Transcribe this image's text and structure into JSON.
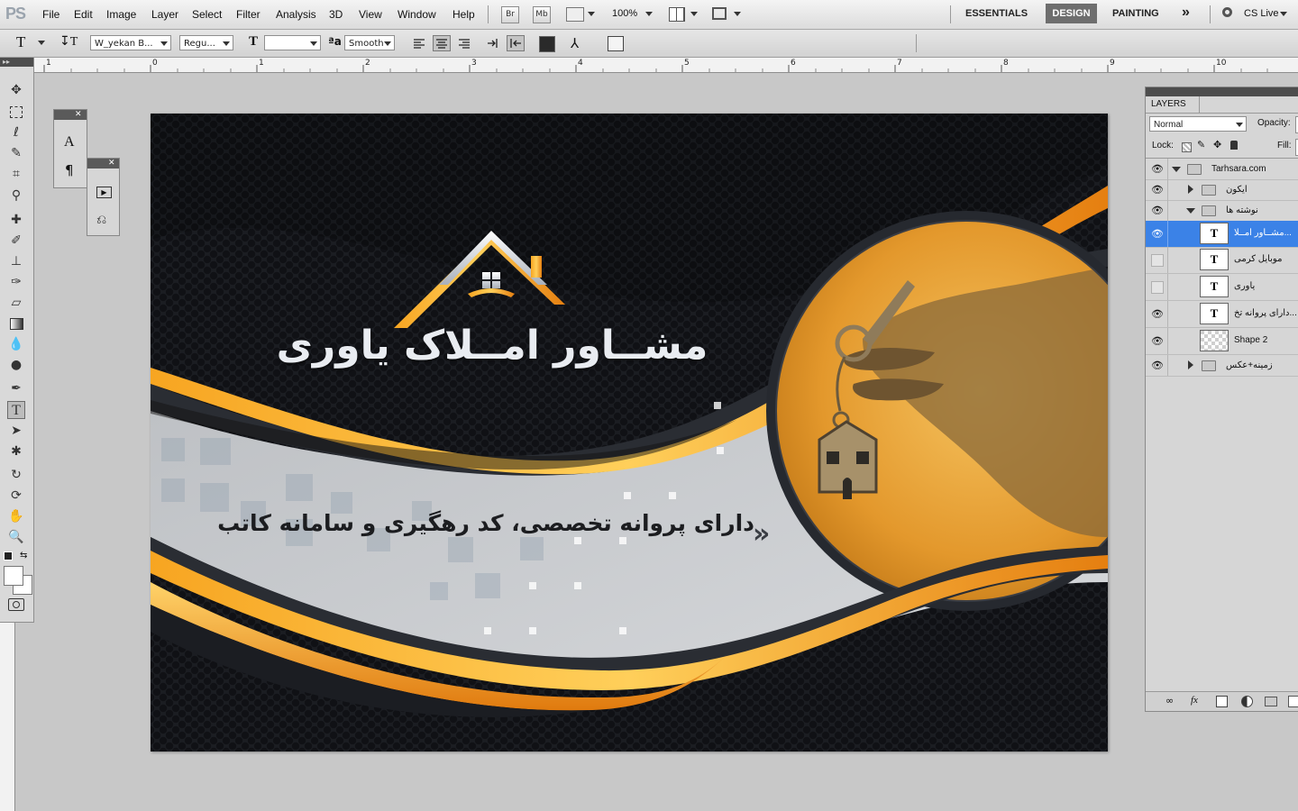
{
  "app": {
    "logo": "PS"
  },
  "menu": [
    "File",
    "Edit",
    "Image",
    "Layer",
    "Select",
    "Filter",
    "Analysis",
    "3D",
    "View",
    "Window",
    "Help"
  ],
  "menubar_buttons": {
    "bridge": "Br",
    "mini_bridge": "Mb",
    "zoom": "100%"
  },
  "workspaces": {
    "essentials": "ESSENTIALS",
    "design": "DESIGN",
    "painting": "PAINTING",
    "more": "»",
    "cs_live": "CS Live"
  },
  "options": {
    "font_family": "W_yekan B...",
    "font_style": "Regu...",
    "font_size": "",
    "aa_label": "a",
    "anti_alias": "Smooth"
  },
  "ruler_numbers": [
    "1",
    "0",
    "1",
    "2",
    "3",
    "4",
    "5",
    "6",
    "7",
    "8",
    "9",
    "10"
  ],
  "card": {
    "company_name": "مشــاور امــلاک یاوری",
    "tagline": "دارای پروانه تخصصی، کد رهگیری و سامانه کاتب",
    "chevrons": "»"
  },
  "layers_panel": {
    "tab": "LAYERS",
    "blend_mode": "Normal",
    "opacity_label": "Opacity:",
    "lock_label": "Lock:",
    "fill_label": "Fill:",
    "text_thumb": "T",
    "layers": [
      {
        "name": "Tarhsara.com",
        "visible": true,
        "type": "group",
        "expanded": true,
        "indent": 0
      },
      {
        "name": "آیکون",
        "visible": true,
        "type": "group",
        "expanded": false,
        "indent": 1
      },
      {
        "name": "نوشته ها",
        "visible": true,
        "type": "group",
        "expanded": true,
        "indent": 1
      },
      {
        "name": "مشــاور امــلا...",
        "visible": true,
        "type": "text",
        "selected": true,
        "indent": 2
      },
      {
        "name": "موبایل کرمی",
        "visible": false,
        "type": "text",
        "indent": 2
      },
      {
        "name": "یاوری",
        "visible": false,
        "type": "text",
        "indent": 2
      },
      {
        "name": "دارای پروانه تخ...",
        "visible": true,
        "type": "text",
        "indent": 2
      },
      {
        "name": "Shape 2",
        "visible": true,
        "type": "shape",
        "indent": 2
      },
      {
        "name": "زمینه+عکس",
        "visible": true,
        "type": "group",
        "expanded": false,
        "indent": 1
      }
    ]
  },
  "colors": {
    "orange": "#f39a1e",
    "dark": "#1b1d22",
    "selection": "#3b82e7"
  }
}
